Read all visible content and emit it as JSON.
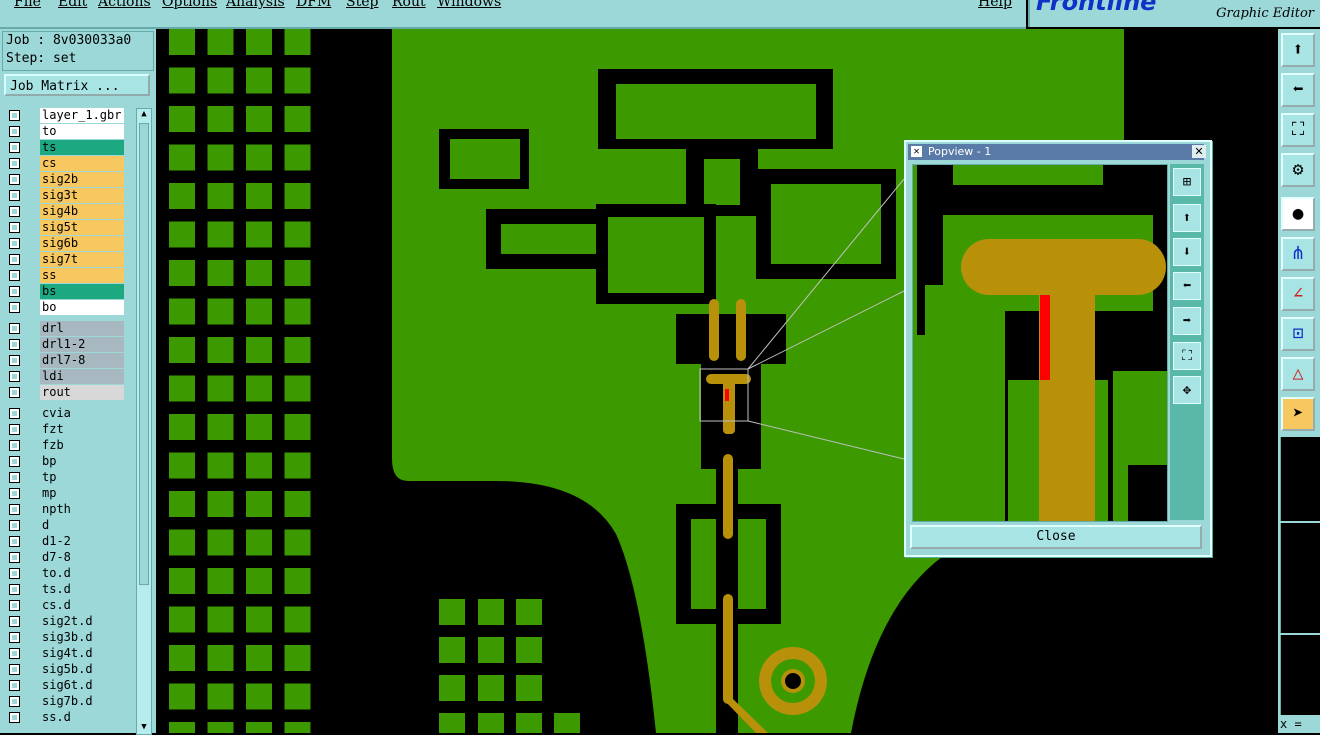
{
  "menu": {
    "items": [
      "File",
      "Edit",
      "Actions",
      "Options",
      "Analysis",
      "DFM",
      "Step",
      "Rout",
      "Windows"
    ],
    "help": "Help"
  },
  "logo": {
    "brand": "Frontline",
    "subtitle": "Graphic Editor"
  },
  "job": {
    "job_line": "Job : 8v030033a0",
    "step_line": "Step: set",
    "matrix_button": "Job Matrix ..."
  },
  "layers": [
    {
      "name": "layer_1.gbr",
      "bg": "#ffffff"
    },
    {
      "name": "to",
      "bg": "#ffffff"
    },
    {
      "name": "ts",
      "bg": "#1ca880"
    },
    {
      "name": "cs",
      "bg": "#f8c860"
    },
    {
      "name": "sig2b",
      "bg": "#f8c860"
    },
    {
      "name": "sig3t",
      "bg": "#f8c860"
    },
    {
      "name": "sig4b",
      "bg": "#f8c860"
    },
    {
      "name": "sig5t",
      "bg": "#f8c860"
    },
    {
      "name": "sig6b",
      "bg": "#f8c860"
    },
    {
      "name": "sig7t",
      "bg": "#f8c860"
    },
    {
      "name": "ss",
      "bg": "#f8c860"
    },
    {
      "name": "bs",
      "bg": "#1ca880"
    },
    {
      "name": "bo",
      "bg": "#ffffff"
    },
    {
      "name": "drl",
      "bg": "#a8b8c0"
    },
    {
      "name": "drl1-2",
      "bg": "#a8b8c0"
    },
    {
      "name": "drl7-8",
      "bg": "#a8b8c0"
    },
    {
      "name": "ldi",
      "bg": "#a8b8c0"
    },
    {
      "name": "rout",
      "bg": "#d8d8d8"
    },
    {
      "name": "cvia",
      "bg": "#9cd8d8"
    },
    {
      "name": "fzt",
      "bg": "#9cd8d8"
    },
    {
      "name": "fzb",
      "bg": "#9cd8d8"
    },
    {
      "name": "bp",
      "bg": "#9cd8d8"
    },
    {
      "name": "tp",
      "bg": "#9cd8d8"
    },
    {
      "name": "mp",
      "bg": "#9cd8d8"
    },
    {
      "name": "npth",
      "bg": "#9cd8d8"
    },
    {
      "name": "d",
      "bg": "#9cd8d8"
    },
    {
      "name": "d1-2",
      "bg": "#9cd8d8"
    },
    {
      "name": "d7-8",
      "bg": "#9cd8d8"
    },
    {
      "name": "to.d",
      "bg": "#9cd8d8"
    },
    {
      "name": "ts.d",
      "bg": "#9cd8d8"
    },
    {
      "name": "cs.d",
      "bg": "#9cd8d8"
    },
    {
      "name": "sig2t.d",
      "bg": "#9cd8d8"
    },
    {
      "name": "sig3b.d",
      "bg": "#9cd8d8"
    },
    {
      "name": "sig4t.d",
      "bg": "#9cd8d8"
    },
    {
      "name": "sig5b.d",
      "bg": "#9cd8d8"
    },
    {
      "name": "sig6t.d",
      "bg": "#9cd8d8"
    },
    {
      "name": "sig7b.d",
      "bg": "#9cd8d8"
    },
    {
      "name": "ss.d",
      "bg": "#9cd8d8"
    }
  ],
  "popview": {
    "title": "Popview - 1",
    "close_label": "Close",
    "close_x": "✕"
  },
  "colors": {
    "board_green": "#3c9a00",
    "copper_gold": "#b8900a",
    "highlight_red": "#ff0000",
    "panel_teal": "#9cd8d8"
  },
  "status": {
    "coord_label": "x ="
  }
}
